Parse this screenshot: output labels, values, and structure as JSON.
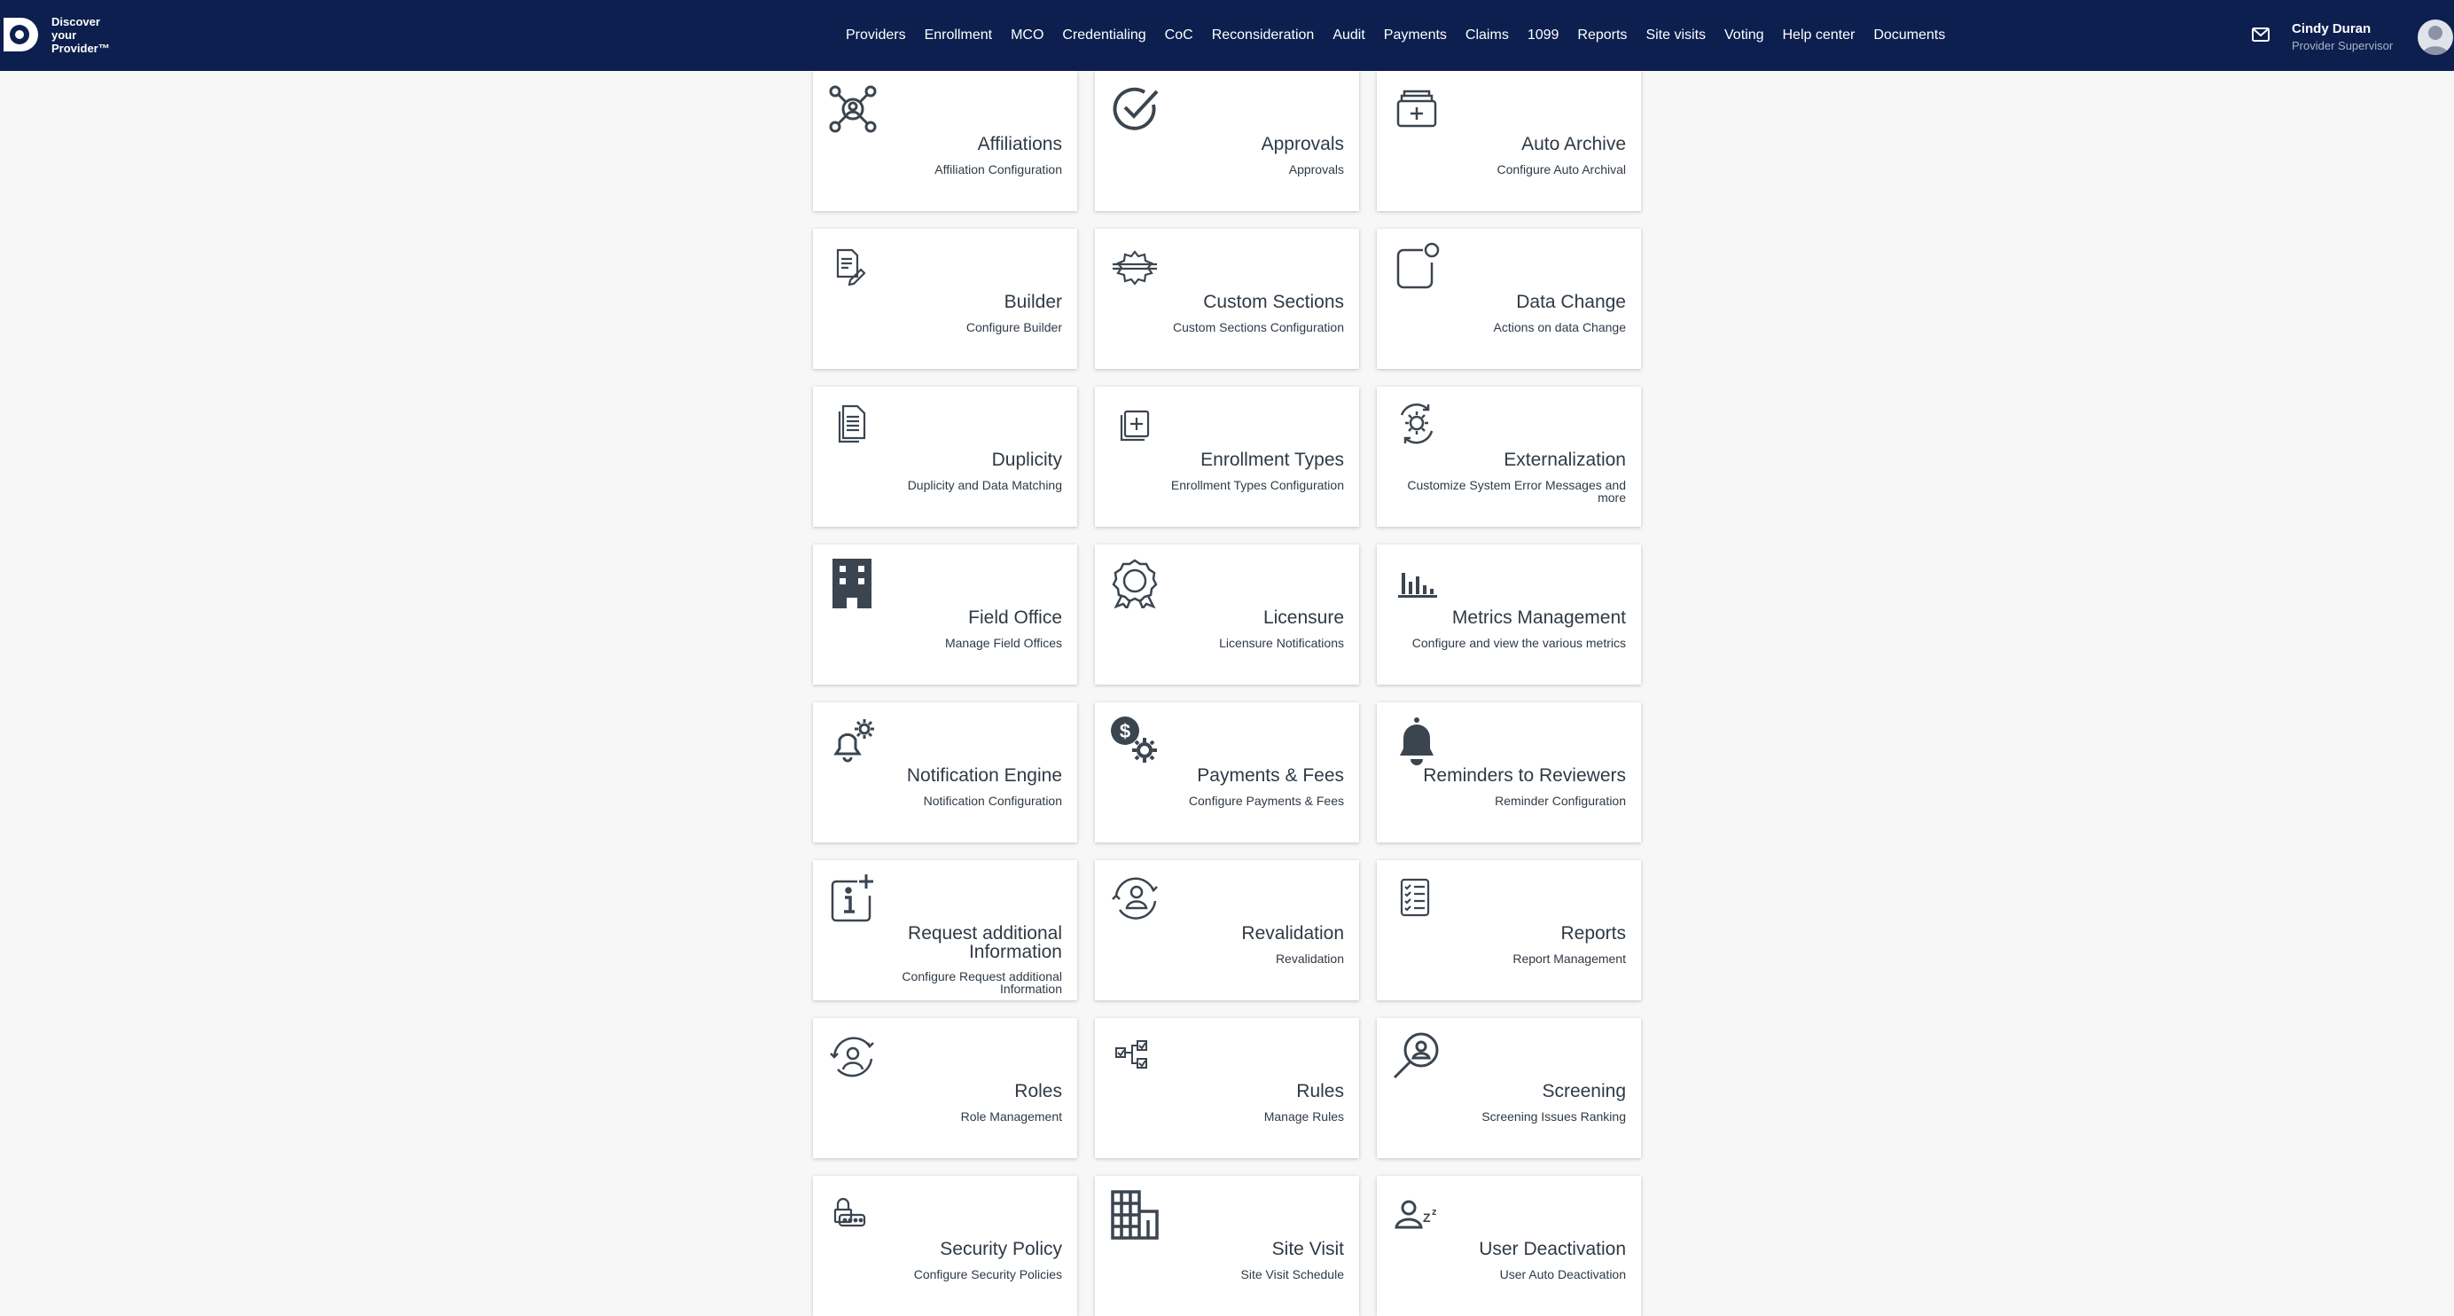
{
  "brand": {
    "line1": "Discover",
    "line2": "your",
    "line3": "Provider™"
  },
  "nav": [
    "Providers",
    "Enrollment",
    "MCO",
    "Credentialing",
    "CoC",
    "Reconsideration",
    "Audit",
    "Payments",
    "Claims",
    "1099",
    "Reports",
    "Site visits",
    "Voting",
    "Help center",
    "Documents"
  ],
  "user": {
    "name": "Cindy Duran",
    "role": "Provider Supervisor"
  },
  "cards": [
    {
      "title": "Affiliations",
      "subtitle": "Affiliation Configuration",
      "icon": "network-icon"
    },
    {
      "title": "Approvals",
      "subtitle": "Approvals",
      "icon": "check-circle-icon"
    },
    {
      "title": "Auto Archive",
      "subtitle": "Configure Auto Archival",
      "icon": "archive-icon"
    },
    {
      "title": "Builder",
      "subtitle": "Configure Builder",
      "icon": "document-edit-icon"
    },
    {
      "title": "Custom Sections",
      "subtitle": "Custom Sections Configuration",
      "icon": "settings-sections-icon"
    },
    {
      "title": "Data Change",
      "subtitle": "Actions on data Change",
      "icon": "notification-square-icon"
    },
    {
      "title": "Duplicity",
      "subtitle": "Duplicity and Data Matching",
      "icon": "duplicate-documents-icon"
    },
    {
      "title": "Enrollment Types",
      "subtitle": "Enrollment Types Configuration",
      "icon": "add-copy-icon"
    },
    {
      "title": "Externalization",
      "subtitle": "Customize System Error Messages and more",
      "icon": "gear-sync-icon"
    },
    {
      "title": "Field Office",
      "subtitle": "Manage Field Offices",
      "icon": "building-icon"
    },
    {
      "title": "Licensure",
      "subtitle": "Licensure Notifications",
      "icon": "badge-icon"
    },
    {
      "title": "Metrics Management",
      "subtitle": "Configure and view the various metrics",
      "icon": "bar-chart-icon"
    },
    {
      "title": "Notification Engine",
      "subtitle": "Notification Configuration",
      "icon": "bell-gear-icon"
    },
    {
      "title": "Payments & Fees",
      "subtitle": "Configure Payments & Fees",
      "icon": "dollar-gear-icon"
    },
    {
      "title": "Reminders to Reviewers",
      "subtitle": "Reminder Configuration",
      "icon": "bell-icon"
    },
    {
      "title": "Request additional Information",
      "subtitle": "Configure Request additional Information",
      "icon": "info-plus-icon"
    },
    {
      "title": "Revalidation",
      "subtitle": "Revalidation",
      "icon": "user-sync-icon"
    },
    {
      "title": "Reports",
      "subtitle": "Report Management",
      "icon": "checklist-icon"
    },
    {
      "title": "Roles",
      "subtitle": "Role Management",
      "icon": "user-cycle-icon"
    },
    {
      "title": "Rules",
      "subtitle": "Manage Rules",
      "icon": "rules-flow-icon"
    },
    {
      "title": "Screening",
      "subtitle": "Screening Issues Ranking",
      "icon": "user-search-icon"
    },
    {
      "title": "Security Policy",
      "subtitle": "Configure Security Policies",
      "icon": "lock-password-icon"
    },
    {
      "title": "Site Visit",
      "subtitle": "Site Visit Schedule",
      "icon": "city-icon"
    },
    {
      "title": "User Deactivation",
      "subtitle": "User Auto Deactivation",
      "icon": "user-sleep-icon"
    }
  ]
}
